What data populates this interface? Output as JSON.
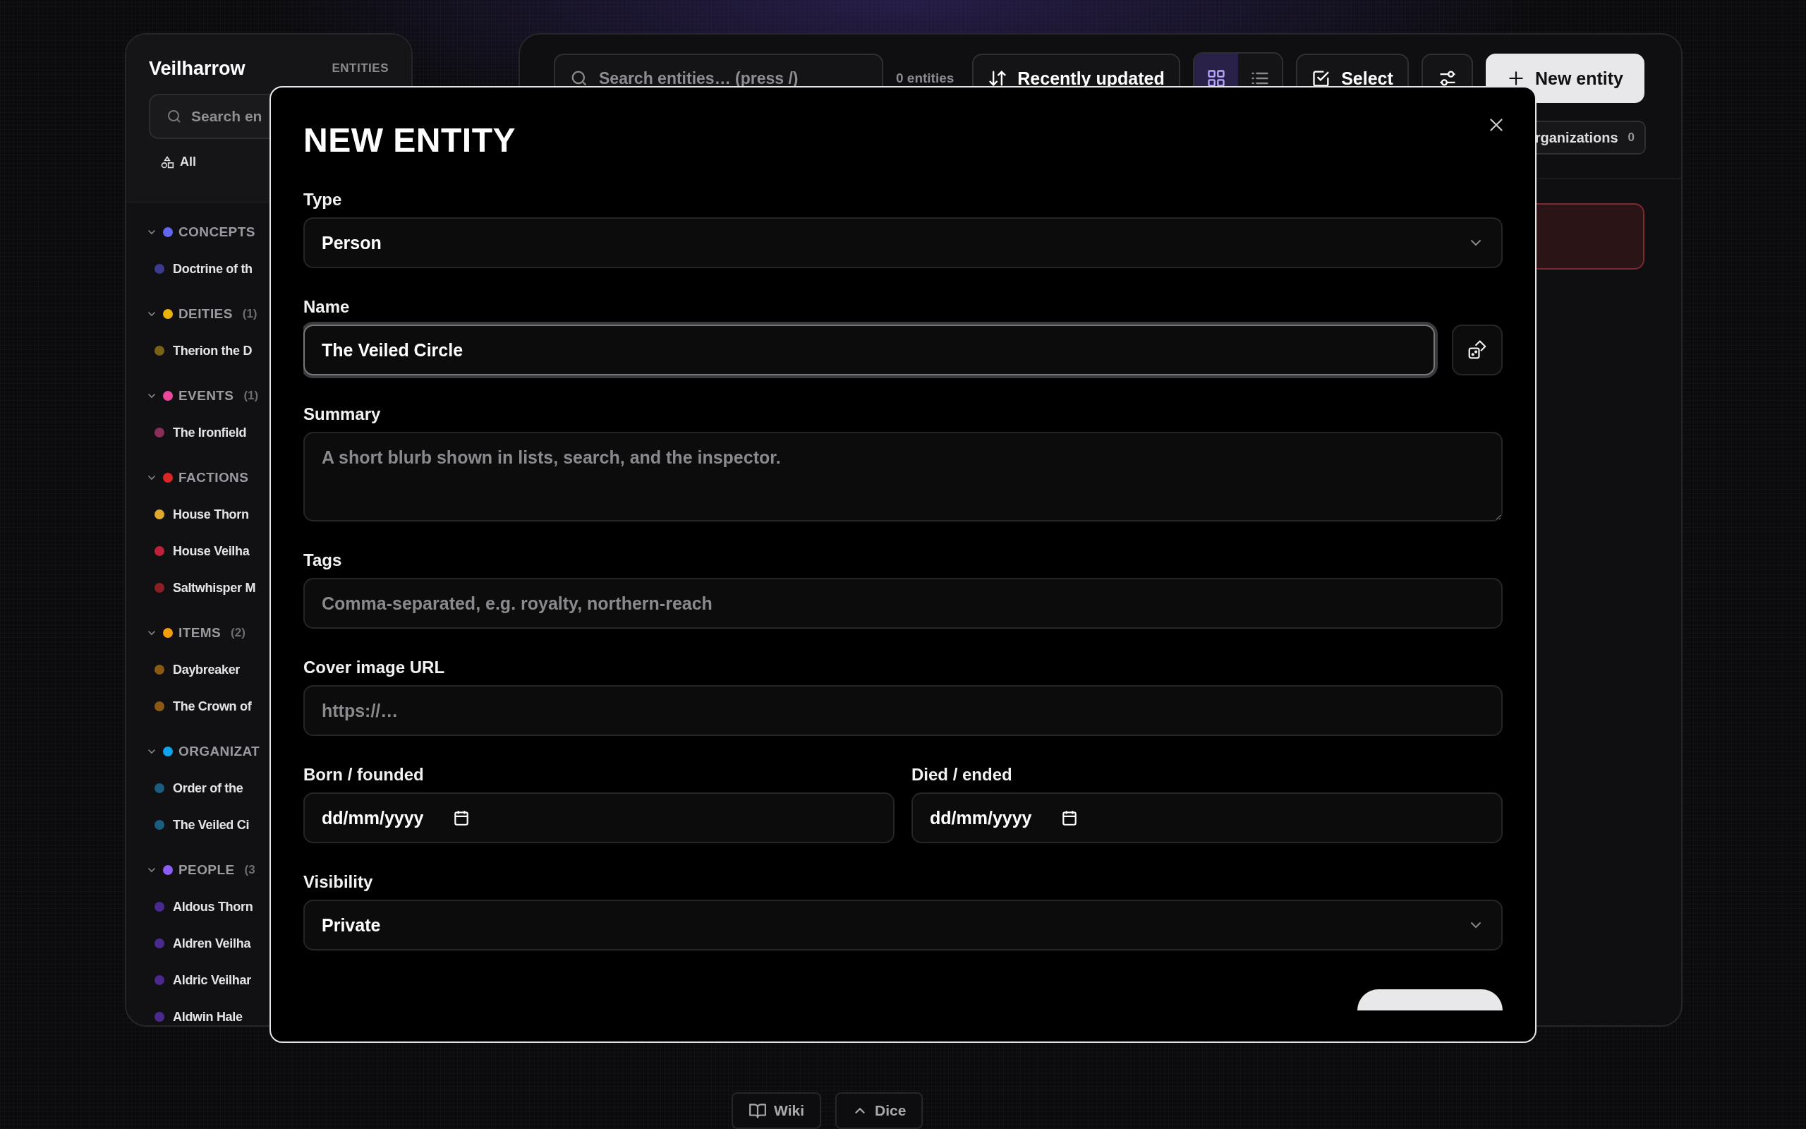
{
  "sidebar": {
    "title": "Veilharrow",
    "section_label": "ENTITIES",
    "search": {
      "placeholder": "Search en"
    },
    "filter": {
      "label": "All"
    },
    "groups": [
      {
        "name": "CONCEPTS",
        "color": "#6366f1",
        "expanded": true,
        "items": [
          {
            "name": "Doctrine of th",
            "color": "#3d3b8e"
          }
        ]
      },
      {
        "name": "DEITIES",
        "count": "(1)",
        "color": "#eab308",
        "expanded": true,
        "items": [
          {
            "name": "Therion the D",
            "color": "#7a6318"
          }
        ]
      },
      {
        "name": "EVENTS",
        "count": "(1)",
        "color": "#ec4899",
        "expanded": true,
        "items": [
          {
            "name": "The Ironfield",
            "color": "#8a2f5a"
          }
        ]
      },
      {
        "name": "FACTIONS",
        "color": "#dc2626",
        "expanded": true,
        "items": [
          {
            "name": "House Thorn",
            "color": "#e0a92e"
          },
          {
            "name": "House Veilha",
            "color": "#c0213a"
          },
          {
            "name": "Saltwhisper M",
            "color": "#8a1f24"
          }
        ]
      },
      {
        "name": "ITEMS",
        "count": "(2)",
        "color": "#f59e0b",
        "expanded": true,
        "items": [
          {
            "name": "Daybreaker",
            "color": "#8a5a14"
          },
          {
            "name": "The Crown of",
            "color": "#8a5a14"
          }
        ]
      },
      {
        "name": "ORGANIZAT",
        "color": "#0ea5e9",
        "expanded": true,
        "items": [
          {
            "name": "Order of the",
            "color": "#1a5d7f"
          },
          {
            "name": "The Veiled Ci",
            "color": "#1a5d7f"
          }
        ]
      },
      {
        "name": "PEOPLE",
        "count": "(3",
        "color": "#8b5cf6",
        "expanded": true,
        "items": [
          {
            "name": "Aldous Thorn",
            "color": "#4b2a8f"
          },
          {
            "name": "Aldren Veilha",
            "color": "#4b2a8f"
          },
          {
            "name": "Aldric Veilhar",
            "color": "#4b2a8f"
          },
          {
            "name": "Aldwin Hale",
            "color": "#4b2a8f"
          }
        ]
      }
    ]
  },
  "toolbar": {
    "search": {
      "placeholder": "Search entities…  (press /)"
    },
    "count": "0 entities",
    "sort": "Recently updated",
    "view_modes": [
      {
        "kind": "grid",
        "selected": true
      },
      {
        "kind": "list",
        "selected": false
      }
    ],
    "select": "Select",
    "new_button": "New entity"
  },
  "chips": [
    {
      "label": "rganizations",
      "count": "0"
    }
  ],
  "modal": {
    "title": "NEW ENTITY",
    "fields": [
      {
        "kind": "select",
        "label": "Type",
        "value": "Person"
      },
      {
        "kind": "text",
        "label": "Name",
        "value": "The Veiled Circle",
        "focused": true,
        "dice": true
      },
      {
        "kind": "textarea",
        "label": "Summary",
        "placeholder": "A short blurb shown in lists, search, and the inspector."
      },
      {
        "kind": "text",
        "label": "Tags",
        "placeholder": "Comma-separated, e.g. royalty, northern-reach",
        "focused": false,
        "dice": false
      },
      {
        "kind": "text",
        "label": "Cover image URL",
        "placeholder": "https://…",
        "focused": false,
        "dice": false
      },
      {
        "kind": "dates",
        "items": [
          {
            "label": "Born / founded",
            "placeholder": "dd/mm/yyyy"
          },
          {
            "label": "Died / ended",
            "placeholder": "dd/mm/yyyy"
          }
        ]
      },
      {
        "kind": "select",
        "label": "Visibility",
        "value": "Private"
      }
    ]
  },
  "dock": [
    {
      "kind": "book",
      "label": "Wiki"
    },
    {
      "kind": "chevron",
      "label": "Dice"
    }
  ]
}
